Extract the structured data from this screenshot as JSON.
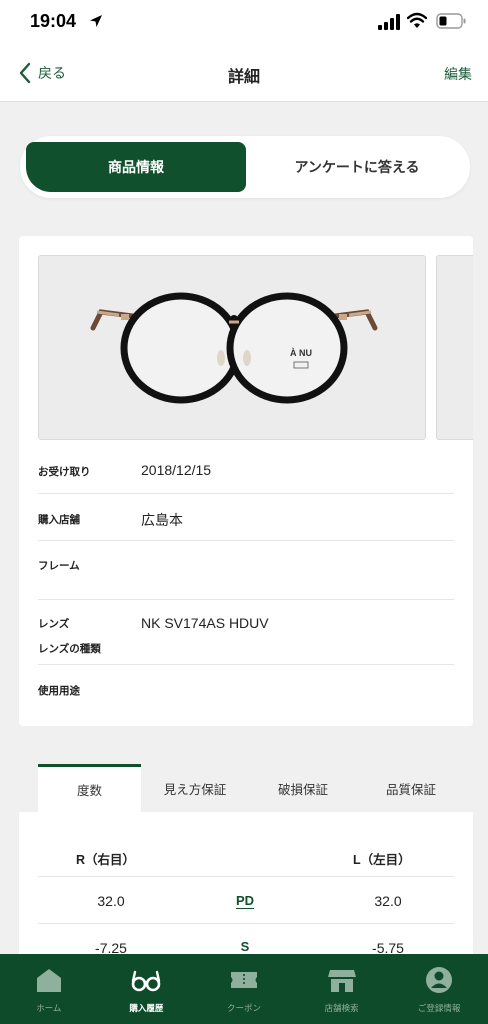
{
  "status_bar": {
    "time": "19:04"
  },
  "nav": {
    "back_label": "戻る",
    "title": "詳細",
    "edit_label": "編集"
  },
  "segments": {
    "active": "商品情報",
    "inactive": "アンケートに答える"
  },
  "product": {
    "brand_mark": "À NU",
    "rows": [
      {
        "label": "お受け取り",
        "value": "2018/12/15"
      },
      {
        "label": "購入店舗",
        "value": "広島本"
      },
      {
        "label": "フレーム",
        "value": ""
      },
      {
        "label": "レンズ",
        "value": "NK SV174AS HDUV",
        "sublabel": "レンズの種類"
      },
      {
        "label": "使用用途",
        "value": ""
      }
    ]
  },
  "tabs": [
    "度数",
    "見え方保証",
    "破損保証",
    "品質保証"
  ],
  "prescription": {
    "right_header": "R（右目）",
    "left_header": "L（左目）",
    "rows": [
      {
        "right": "32.0",
        "label": "PD",
        "left": "32.0"
      },
      {
        "right": "-7.25",
        "label": "S",
        "left": "-5.75"
      }
    ]
  },
  "tab_bar": [
    {
      "label": "ホーム",
      "icon": "home-icon"
    },
    {
      "label": "購入履歴",
      "icon": "glasses-icon"
    },
    {
      "label": "クーポン",
      "icon": "ticket-icon"
    },
    {
      "label": "店舗検索",
      "icon": "store-icon"
    },
    {
      "label": "ご登録情報",
      "icon": "person-icon"
    }
  ],
  "colors": {
    "brand_green": "#10502d",
    "tab_bar_bg": "#0e4b2a"
  }
}
